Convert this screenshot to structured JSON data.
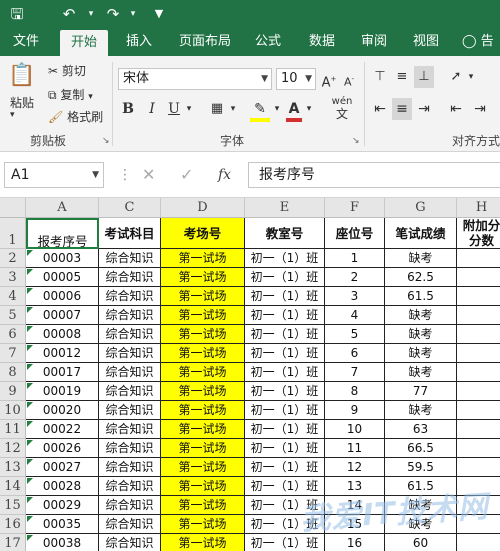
{
  "titlebar": {
    "save_icon": "save-icon",
    "undo_icon": "undo-icon",
    "redo_icon": "redo-icon",
    "customize_icon": "customize-icon",
    "accent": "#217346"
  },
  "tabs": [
    "文件",
    "开始",
    "插入",
    "页面布局",
    "公式",
    "数据",
    "审阅",
    "视图",
    "告"
  ],
  "active_tab": "开始",
  "clipboard": {
    "paste": "粘贴",
    "cut": "剪切",
    "copy": "复制",
    "format_painter": "格式刷",
    "group": "剪贴板"
  },
  "font": {
    "name": "宋体",
    "size": "10",
    "bold": "B",
    "italic": "I",
    "underline": "U",
    "wen": "wén",
    "group": "字体",
    "font_color": "#d32f2f",
    "fill_color": "#ffff00"
  },
  "alignment": {
    "group": "对齐方式"
  },
  "formula_bar": {
    "name_box": "A1",
    "content": "报考序号",
    "fx": "fx"
  },
  "columns": [
    "A",
    "C",
    "D",
    "E",
    "F",
    "G",
    "H"
  ],
  "headers": [
    "报考序号",
    "考试科目",
    "考场号",
    "教室号",
    "座位号",
    "笔试成绩",
    "附加分分数"
  ],
  "rows": [
    {
      "n": "2",
      "id": "00003",
      "subject": "综合知识",
      "room": "第一试场",
      "class": "初一（1）班",
      "seat": "1",
      "score": "缺考"
    },
    {
      "n": "3",
      "id": "00005",
      "subject": "综合知识",
      "room": "第一试场",
      "class": "初一（1）班",
      "seat": "2",
      "score": "62.5"
    },
    {
      "n": "4",
      "id": "00006",
      "subject": "综合知识",
      "room": "第一试场",
      "class": "初一（1）班",
      "seat": "3",
      "score": "61.5"
    },
    {
      "n": "5",
      "id": "00007",
      "subject": "综合知识",
      "room": "第一试场",
      "class": "初一（1）班",
      "seat": "4",
      "score": "缺考"
    },
    {
      "n": "6",
      "id": "00008",
      "subject": "综合知识",
      "room": "第一试场",
      "class": "初一（1）班",
      "seat": "5",
      "score": "缺考"
    },
    {
      "n": "7",
      "id": "00012",
      "subject": "综合知识",
      "room": "第一试场",
      "class": "初一（1）班",
      "seat": "6",
      "score": "缺考"
    },
    {
      "n": "8",
      "id": "00017",
      "subject": "综合知识",
      "room": "第一试场",
      "class": "初一（1）班",
      "seat": "7",
      "score": "缺考"
    },
    {
      "n": "9",
      "id": "00019",
      "subject": "综合知识",
      "room": "第一试场",
      "class": "初一（1）班",
      "seat": "8",
      "score": "77"
    },
    {
      "n": "10",
      "id": "00020",
      "subject": "综合知识",
      "room": "第一试场",
      "class": "初一（1）班",
      "seat": "9",
      "score": "缺考"
    },
    {
      "n": "11",
      "id": "00022",
      "subject": "综合知识",
      "room": "第一试场",
      "class": "初一（1）班",
      "seat": "10",
      "score": "63"
    },
    {
      "n": "12",
      "id": "00026",
      "subject": "综合知识",
      "room": "第一试场",
      "class": "初一（1）班",
      "seat": "11",
      "score": "66.5"
    },
    {
      "n": "13",
      "id": "00027",
      "subject": "综合知识",
      "room": "第一试场",
      "class": "初一（1）班",
      "seat": "12",
      "score": "59.5"
    },
    {
      "n": "14",
      "id": "00028",
      "subject": "综合知识",
      "room": "第一试场",
      "class": "初一（1）班",
      "seat": "13",
      "score": "61.5"
    },
    {
      "n": "15",
      "id": "00029",
      "subject": "综合知识",
      "room": "第一试场",
      "class": "初一（1）班",
      "seat": "14",
      "score": "缺考"
    },
    {
      "n": "16",
      "id": "00035",
      "subject": "综合知识",
      "room": "第一试场",
      "class": "初一（1）班",
      "seat": "15",
      "score": "缺考"
    },
    {
      "n": "17",
      "id": "00038",
      "subject": "综合知识",
      "room": "第一试场",
      "class": "初一（1）班",
      "seat": "16",
      "score": "60"
    }
  ],
  "header_row_num": "1",
  "watermark": "我爱IT技术网"
}
